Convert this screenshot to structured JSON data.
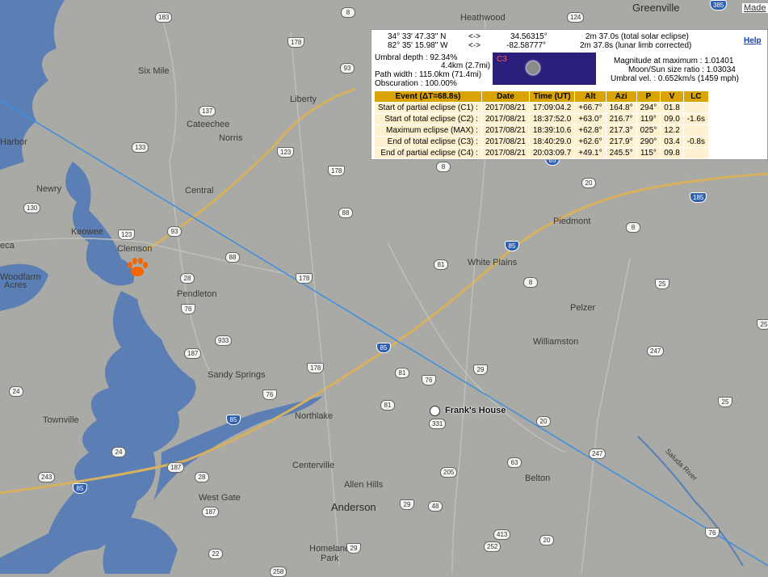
{
  "map": {
    "towns": [
      {
        "name": "Heathwood",
        "big": false
      },
      {
        "name": "Greenville",
        "big": true
      },
      {
        "name": "Six Mile",
        "big": false
      },
      {
        "name": "Liberty",
        "big": false
      },
      {
        "name": "Harbor",
        "big": false
      },
      {
        "name": "Cateechee",
        "big": false
      },
      {
        "name": "Norris",
        "big": false
      },
      {
        "name": "Newry",
        "big": false
      },
      {
        "name": "Central",
        "big": false
      },
      {
        "name": "Keowee",
        "big": false
      },
      {
        "name": "Clemson",
        "big": false
      },
      {
        "name": "eca",
        "big": false
      },
      {
        "name": "Woodfarm",
        "big": false
      },
      {
        "name": "Acres",
        "big": false
      },
      {
        "name": "Pendleton",
        "big": false
      },
      {
        "name": "Piedmont",
        "big": false
      },
      {
        "name": "White Plains",
        "big": false
      },
      {
        "name": "Pelzer",
        "big": false
      },
      {
        "name": "Williamston",
        "big": false
      },
      {
        "name": "Sandy Springs",
        "big": false
      },
      {
        "name": "Townville",
        "big": false
      },
      {
        "name": "Northlake",
        "big": false
      },
      {
        "name": "Centerville",
        "big": false
      },
      {
        "name": "Allen Hills",
        "big": false
      },
      {
        "name": "Anderson",
        "big": true
      },
      {
        "name": "Belton",
        "big": false
      },
      {
        "name": "West Gate",
        "big": false
      },
      {
        "name": "Homeland",
        "big": false
      },
      {
        "name": "Park",
        "big": false
      },
      {
        "name": "Saluda River",
        "big": false
      }
    ],
    "shields": [
      {
        "num": "183",
        "kind": "state"
      },
      {
        "num": "8",
        "kind": "state"
      },
      {
        "num": "124",
        "kind": "state"
      },
      {
        "num": "385",
        "kind": "int"
      },
      {
        "num": "178",
        "kind": "us"
      },
      {
        "name": "",
        "num": "93",
        "kind": "state"
      },
      {
        "num": "137",
        "kind": "state"
      },
      {
        "num": "133",
        "kind": "state"
      },
      {
        "num": "123",
        "kind": "us"
      },
      {
        "num": "178",
        "kind": "us"
      },
      {
        "num": "8",
        "kind": "state"
      },
      {
        "num": "20",
        "kind": "state"
      },
      {
        "num": "85",
        "kind": "int"
      },
      {
        "num": "185",
        "kind": "int"
      },
      {
        "num": "130",
        "kind": "state"
      },
      {
        "num": "123",
        "kind": "us"
      },
      {
        "num": "93",
        "kind": "state"
      },
      {
        "num": "88",
        "kind": "state"
      },
      {
        "num": "88",
        "kind": "state"
      },
      {
        "num": "28",
        "kind": "state"
      },
      {
        "num": "76",
        "kind": "us"
      },
      {
        "num": "178",
        "kind": "us"
      },
      {
        "num": "81",
        "kind": "state"
      },
      {
        "num": "85",
        "kind": "int"
      },
      {
        "num": "8",
        "kind": "state"
      },
      {
        "num": "25",
        "kind": "us"
      },
      {
        "num": "8",
        "kind": "state"
      },
      {
        "num": "933",
        "kind": "state"
      },
      {
        "num": "187",
        "kind": "state"
      },
      {
        "num": "85",
        "kind": "int"
      },
      {
        "num": "81",
        "kind": "state"
      },
      {
        "num": "178",
        "kind": "us"
      },
      {
        "num": "29",
        "kind": "us"
      },
      {
        "num": "247",
        "kind": "state"
      },
      {
        "num": "24",
        "kind": "state"
      },
      {
        "num": "76",
        "kind": "us"
      },
      {
        "num": "76",
        "kind": "us"
      },
      {
        "num": "81",
        "kind": "state"
      },
      {
        "num": "85",
        "kind": "int"
      },
      {
        "num": "331",
        "kind": "state"
      },
      {
        "num": "20",
        "kind": "state"
      },
      {
        "num": "25",
        "kind": "us"
      },
      {
        "num": "24",
        "kind": "state"
      },
      {
        "num": "187",
        "kind": "state"
      },
      {
        "num": "247",
        "kind": "state"
      },
      {
        "num": "243",
        "kind": "state"
      },
      {
        "num": "85",
        "kind": "int"
      },
      {
        "num": "28",
        "kind": "state"
      },
      {
        "num": "205",
        "kind": "state"
      },
      {
        "num": "63",
        "kind": "state"
      },
      {
        "num": "187",
        "kind": "state"
      },
      {
        "num": "29",
        "kind": "us"
      },
      {
        "num": "48",
        "kind": "state"
      },
      {
        "num": "20",
        "kind": "state"
      },
      {
        "num": "76",
        "kind": "us"
      },
      {
        "num": "413",
        "kind": "state"
      },
      {
        "num": "22",
        "kind": "state"
      },
      {
        "num": "252",
        "kind": "state"
      },
      {
        "num": "29",
        "kind": "us"
      },
      {
        "num": "258",
        "kind": "state"
      },
      {
        "num": "25",
        "kind": "us"
      }
    ],
    "marker_label": "Frank's House",
    "made_label": "Made",
    "colors": {
      "land": "#a9a9a6",
      "water": "#5b7fb5",
      "road": "#d8b15e",
      "path_line": "#3d8fe0",
      "marker": "#ffffff"
    }
  },
  "panel": {
    "lat_dms": "34° 33' 47.33\" N",
    "lat_arrow": "<->",
    "lat_dec": "34.56315°",
    "dur_total": "2m 37.0s (total solar eclipse)",
    "help": "Help",
    "lon_dms": "82° 35' 15.98\" W",
    "lon_arrow": "<->",
    "lon_dec": "-82.58777°",
    "dur_limb": "2m 37.8s (lunar limb corrected)",
    "umbral_depth": "Umbral depth : 92.34%",
    "umbral_depth2": "4.4km (2.7mi)",
    "path_width": "Path width : 115.0km (71.4mi)",
    "obscuration": "Obscuration : 100.00%",
    "c3_label": "C3",
    "magnitude": "Magnitude at maximum : 1.01401",
    "size_ratio": "Moon/Sun size ratio : 1.03034",
    "umbral_vel": "Umbral vel. : 0.652km/s (1459 mph)",
    "headers": [
      "Event (ΔT=68.8s)",
      "Date",
      "Time (UT)",
      "Alt",
      "Azi",
      "P",
      "V",
      "LC"
    ],
    "rows": [
      [
        "Start of partial eclipse (C1) :",
        "2017/08/21",
        "17:09:04.2",
        "+66.7°",
        "164.8°",
        "294°",
        "01.8",
        ""
      ],
      [
        "Start of total eclipse (C2) :",
        "2017/08/21",
        "18:37:52.0",
        "+63.0°",
        "216.7°",
        "119°",
        "09.0",
        "-1.6s"
      ],
      [
        "Maximum eclipse (MAX) :",
        "2017/08/21",
        "18:39:10.6",
        "+62.8°",
        "217.3°",
        "025°",
        "12.2",
        ""
      ],
      [
        "End of total eclipse (C3) :",
        "2017/08/21",
        "18:40:29.0",
        "+62.6°",
        "217.9°",
        "290°",
        "03.4",
        "-0.8s"
      ],
      [
        "End of partial eclipse (C4) :",
        "2017/08/21",
        "20:03:09.7",
        "+49.1°",
        "245.5°",
        "115°",
        "09.8",
        ""
      ]
    ]
  }
}
